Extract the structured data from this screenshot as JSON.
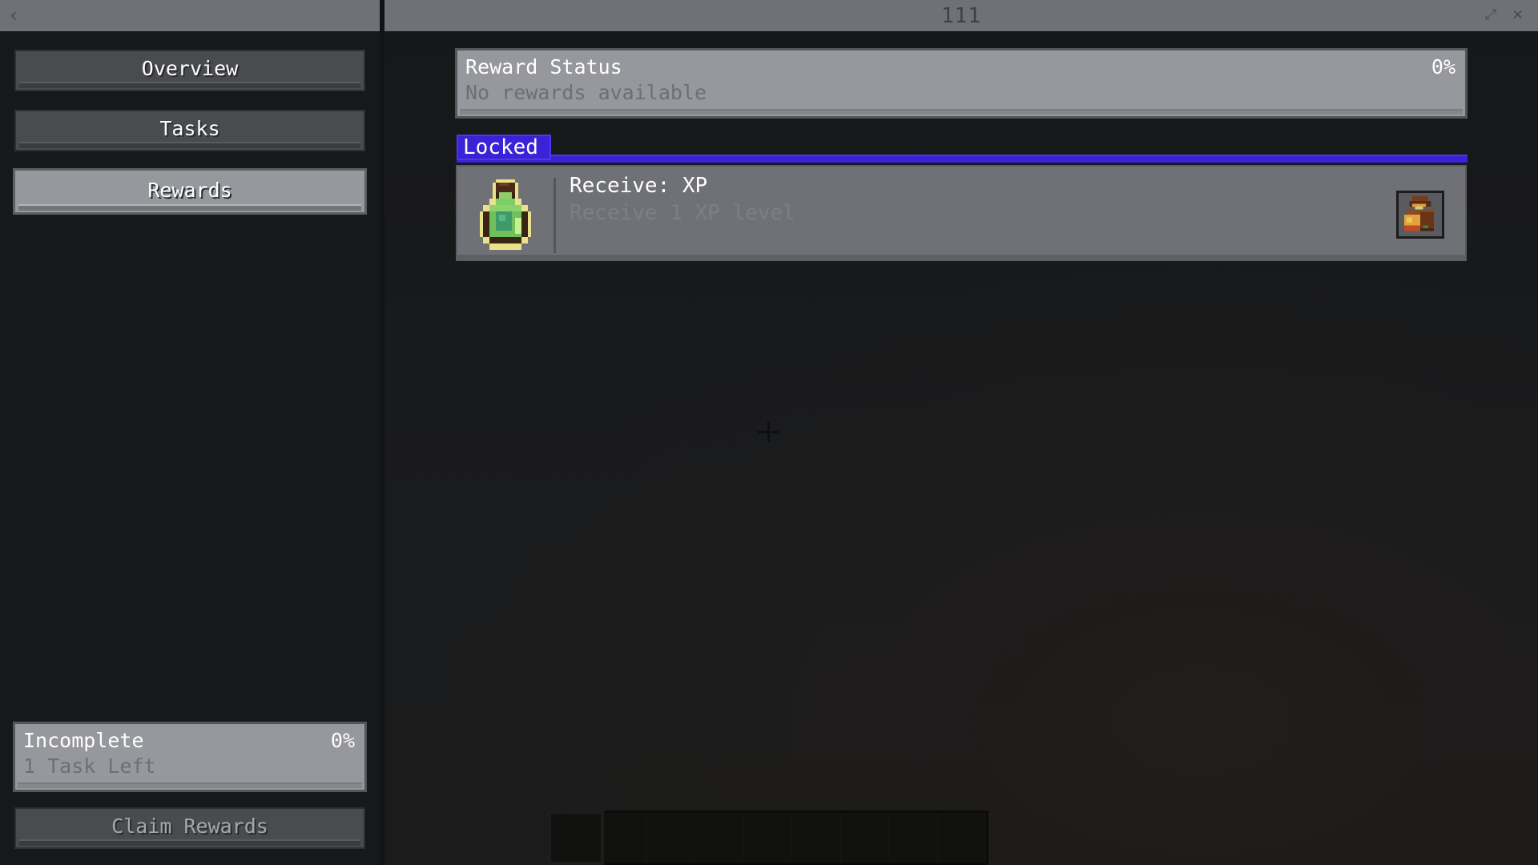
{
  "window": {
    "title": "111",
    "back_icon": "chevron-left-icon",
    "popout_icon": "popout-icon",
    "close_icon": "close-icon"
  },
  "sidebar": {
    "items": [
      {
        "label": "Overview",
        "active": false
      },
      {
        "label": "Tasks",
        "active": false
      },
      {
        "label": "Rewards",
        "active": true
      }
    ],
    "progress": {
      "status": "Incomplete",
      "detail": "1 Task Left",
      "percent_label": "0%",
      "percent": 0
    },
    "claim_button": {
      "label": "Claim Rewards",
      "enabled": false
    }
  },
  "main": {
    "reward_status": {
      "title": "Reward Status",
      "subtitle": "No rewards available",
      "percent_label": "0%",
      "percent": 0
    },
    "groups": [
      {
        "label": "Locked",
        "color": "#3a22d6",
        "rewards": [
          {
            "icon": "xp-bottle-icon",
            "title": "Receive: XP",
            "description": "Receive 1 XP level",
            "action_icon": "loot-bag-icon"
          }
        ]
      }
    ]
  },
  "colors": {
    "accent_locked": "#3a22d6",
    "panel": "#97989d",
    "titlebar": "#707176",
    "background": "#17181b"
  }
}
